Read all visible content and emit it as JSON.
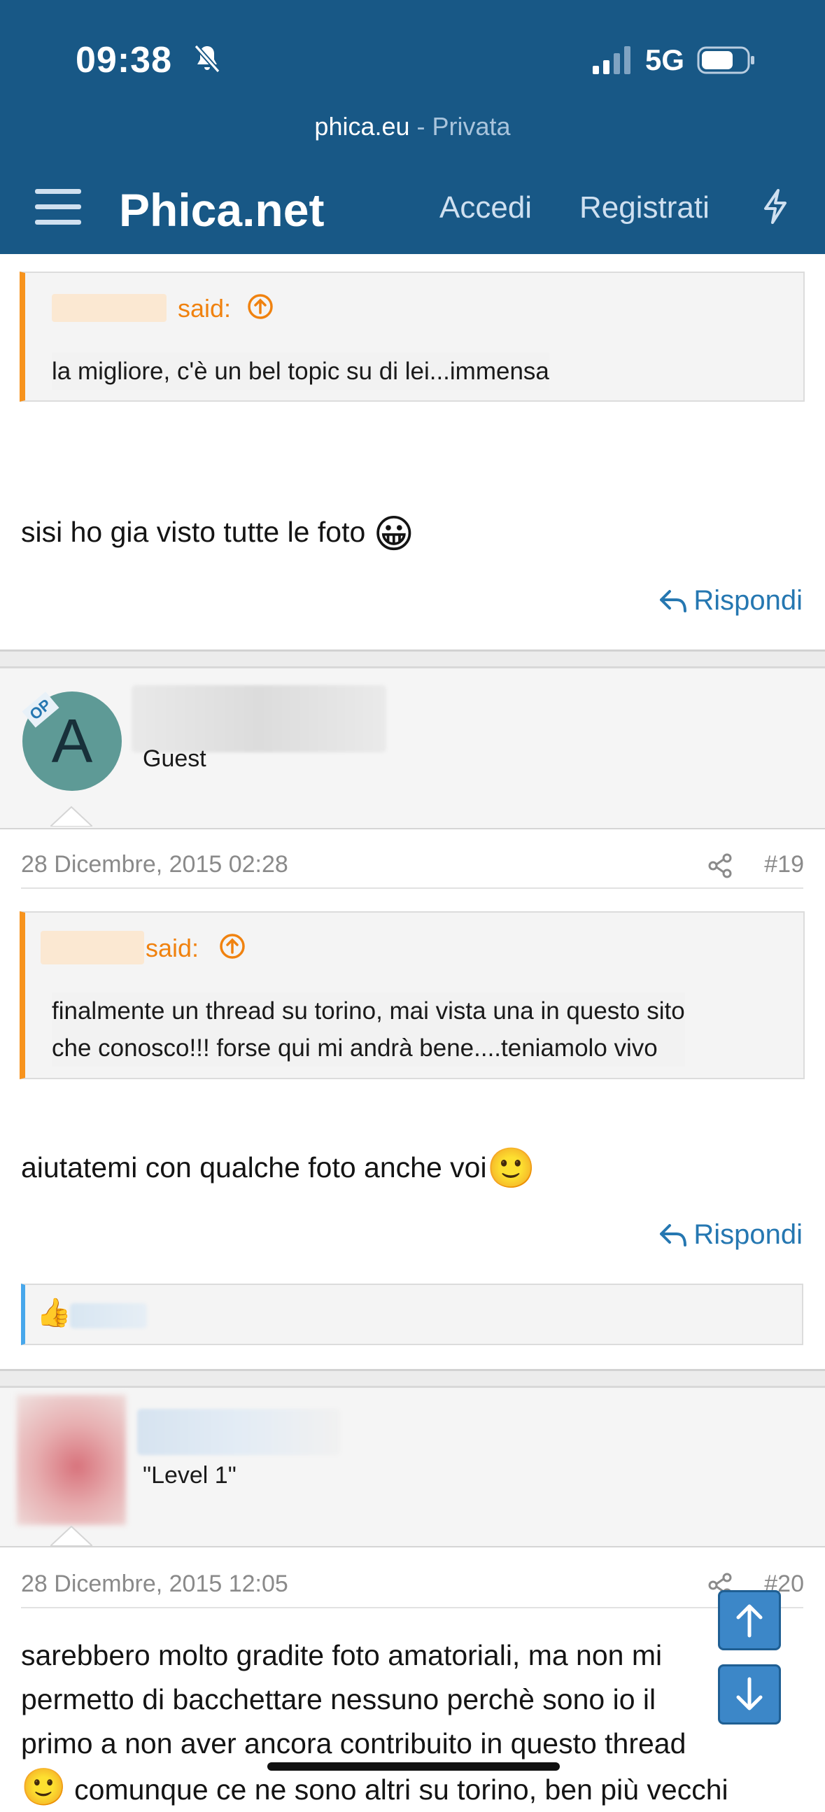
{
  "status_bar": {
    "time": "09:38",
    "network": "5G"
  },
  "url_bar": {
    "host": "phica.eu",
    "mode": " - Privata"
  },
  "header": {
    "brand": "Phica.net",
    "login": "Accedi",
    "register": "Registrati"
  },
  "post18": {
    "quote_said": "said:",
    "quote_text": "la migliore, c'è un bel topic su di lei...immensa",
    "body": "sisi ho gia visto tutte le foto",
    "emoji": "😀",
    "reply": "Rispondi"
  },
  "post19": {
    "avatar_letter": "A",
    "op_badge": "OP",
    "user_title": "Guest",
    "date": "28 Dicembre, 2015 02:28",
    "number": "#19",
    "quote_said": "said:",
    "quote_line1": "finalmente un thread su torino, mai vista una in questo sito",
    "quote_line2": "che conosco!!! forse qui mi andrà bene....teniamolo vivo",
    "body": "aiutatemi con qualche foto anche voi",
    "emoji": "🙂",
    "reply": "Rispondi",
    "reaction_emoji": "👍"
  },
  "post20": {
    "user_title": "\"Level 1\"",
    "date": "28 Dicembre, 2015 12:05",
    "number": "#20",
    "line1": "sarebbero molto gradite foto amatoriali, ma non mi",
    "line2": "permetto di bacchettare nessuno perchè sono io il",
    "line3": "primo a non aver ancora contribuito in questo thread",
    "line4": "comunque ce ne sono altri su torino, ben più vecchi",
    "emoji": "🙂"
  },
  "colors": {
    "header_bg": "#185886",
    "accent_orange": "#f7931d",
    "link_blue": "#2577b1",
    "fab_blue": "#3c87c8"
  },
  "icons": [
    "bell-slash-icon",
    "signal-icon",
    "battery-icon",
    "hamburger-menu-icon",
    "bolt-icon",
    "arrow-circle-up-icon",
    "reply-arrow-icon",
    "share-icon",
    "scroll-up-icon",
    "scroll-down-icon"
  ]
}
